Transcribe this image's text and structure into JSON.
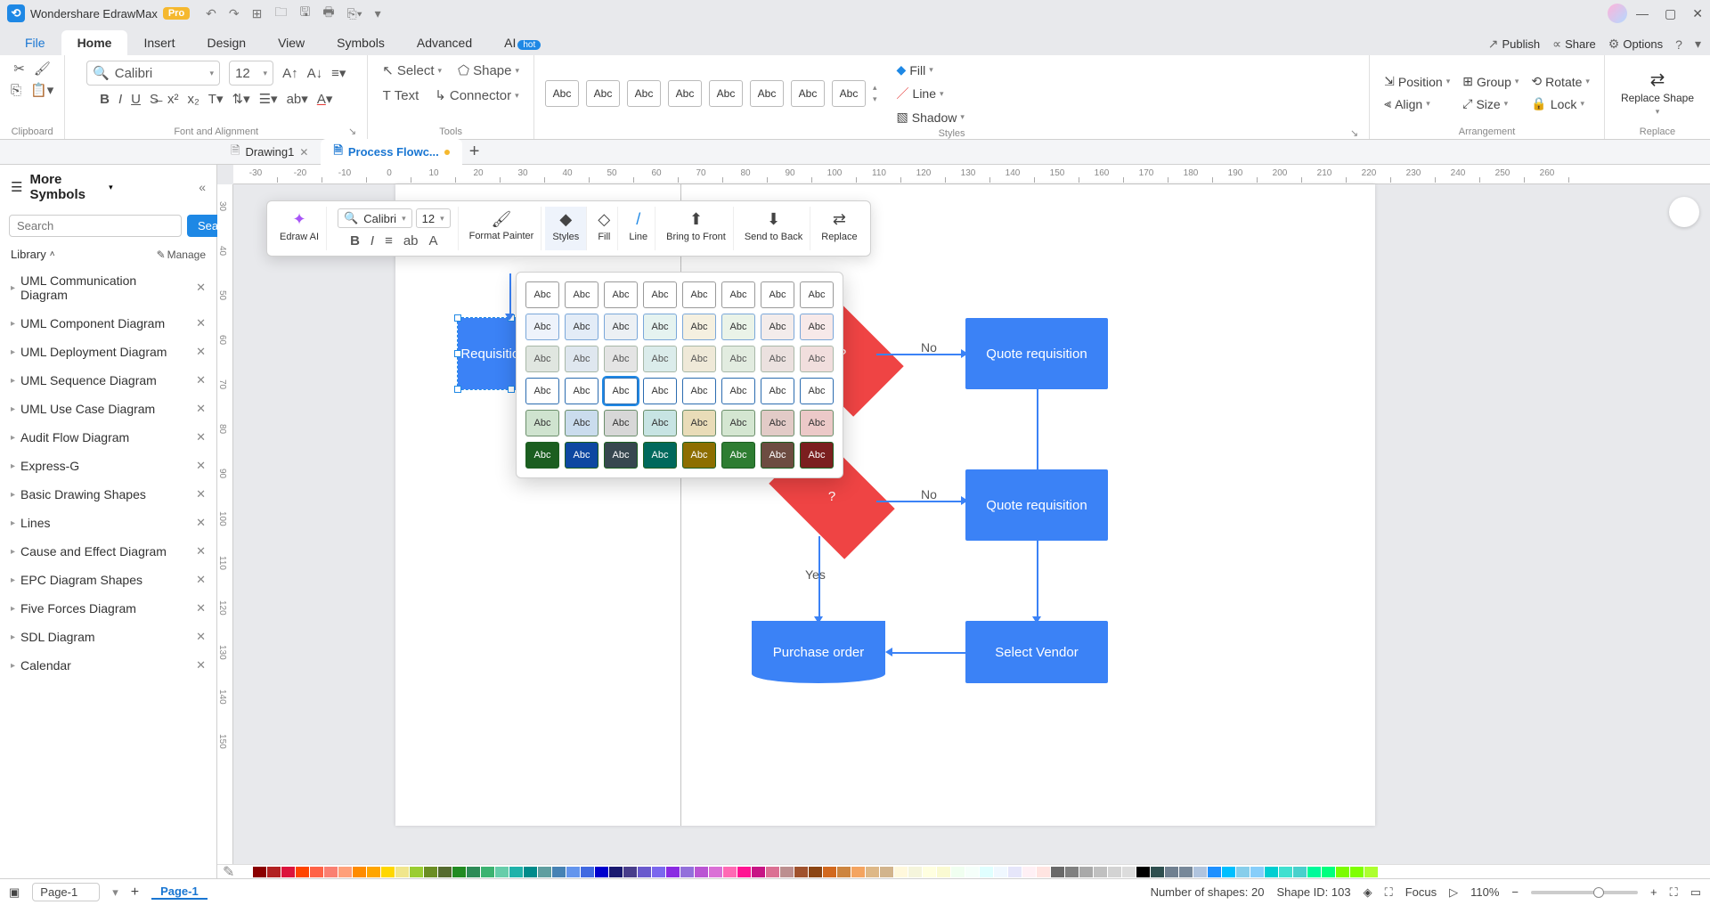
{
  "app": {
    "title": "Wondershare EdrawMax",
    "pro": "Pro"
  },
  "menu": {
    "file": "File",
    "home": "Home",
    "insert": "Insert",
    "design": "Design",
    "view": "View",
    "symbols": "Symbols",
    "advanced": "Advanced",
    "ai": "AI",
    "ai_badge": "hot"
  },
  "top_right": {
    "publish": "Publish",
    "share": "Share",
    "options": "Options"
  },
  "ribbon": {
    "clipboard": "Clipboard",
    "font_alignment": "Font and Alignment",
    "font_name": "Calibri",
    "font_size": "12",
    "tools": "Tools",
    "select": "Select",
    "text": "Text",
    "shape": "Shape",
    "connector": "Connector",
    "styles": "Styles",
    "style_swatch": "Abc",
    "fill": "Fill",
    "line": "Line",
    "shadow": "Shadow",
    "arrangement": "Arrangement",
    "position": "Position",
    "align": "Align",
    "group": "Group",
    "size": "Size",
    "rotate": "Rotate",
    "lock": "Lock",
    "replace": "Replace",
    "replace_shape": "Replace Shape"
  },
  "doc_tabs": {
    "drawing1": "Drawing1",
    "process": "Process Flowc..."
  },
  "sidebar": {
    "title": "More Symbols",
    "search_placeholder": "Search",
    "search_btn": "Search",
    "library": "Library",
    "manage": "Manage",
    "items": [
      "UML Communication Diagram",
      "UML Component Diagram",
      "UML Deployment Diagram",
      "UML Sequence Diagram",
      "UML Use Case Diagram",
      "Audit Flow Diagram",
      "Express-G",
      "Basic Drawing Shapes",
      "Lines",
      "Cause and Effect Diagram",
      "EPC Diagram Shapes",
      "Five Forces Diagram",
      "SDL Diagram",
      "Calendar"
    ]
  },
  "mini_toolbar": {
    "edraw_ai": "Edraw AI",
    "font_name": "Calibri",
    "font_size": "12",
    "format_painter": "Format Painter",
    "styles": "Styles",
    "fill": "Fill",
    "line": "Line",
    "bring_front": "Bring to Front",
    "send_back": "Send to Back",
    "replace": "Replace"
  },
  "style_swatch": "Abc",
  "canvas": {
    "requisition_form": "Requisition Form",
    "quote_req1": "Quote requisition",
    "quote_req2": "Quote requisition",
    "purchase_order": "Purchase order",
    "select_vendor": "Select Vendor",
    "decision_q": "t?",
    "decision2_q": "?",
    "no": "No",
    "yes": "Yes"
  },
  "ruler_h": [
    "-30",
    "-20",
    "-10",
    "0",
    "10",
    "20",
    "30",
    "40",
    "50",
    "60",
    "70",
    "80",
    "90",
    "100",
    "110",
    "120",
    "130",
    "140",
    "150",
    "160",
    "170",
    "180",
    "190",
    "200",
    "210",
    "220",
    "230",
    "240",
    "250",
    "260"
  ],
  "ruler_v": [
    "30",
    "40",
    "50",
    "60",
    "70",
    "80",
    "90",
    "100",
    "110",
    "120",
    "130",
    "140",
    "150"
  ],
  "status": {
    "page_sel": "Page-1",
    "page_tab": "Page-1",
    "shapes": "Number of shapes: 20",
    "shape_id": "Shape ID: 103",
    "focus": "Focus",
    "zoom": "110%"
  },
  "color_strip": [
    "#ffffff",
    "#8b0000",
    "#b22222",
    "#dc143c",
    "#ff4500",
    "#ff6347",
    "#fa8072",
    "#ffa07a",
    "#ff8c00",
    "#ffa500",
    "#ffd700",
    "#f0e68c",
    "#9acd32",
    "#6b8e23",
    "#556b2f",
    "#228b22",
    "#2e8b57",
    "#3cb371",
    "#66cdaa",
    "#20b2aa",
    "#008b8b",
    "#5f9ea0",
    "#4682b4",
    "#6495ed",
    "#4169e1",
    "#0000cd",
    "#191970",
    "#483d8b",
    "#6a5acd",
    "#7b68ee",
    "#8a2be2",
    "#9370db",
    "#ba55d3",
    "#da70d6",
    "#ff69b4",
    "#ff1493",
    "#c71585",
    "#db7093",
    "#bc8f8f",
    "#a0522d",
    "#8b4513",
    "#d2691e",
    "#cd853f",
    "#f4a460",
    "#deb887",
    "#d2b48c",
    "#fff8dc",
    "#f5f5dc",
    "#ffffe0",
    "#fafad2",
    "#f0fff0",
    "#f5fffa",
    "#e0ffff",
    "#f0f8ff",
    "#e6e6fa",
    "#fff0f5",
    "#ffe4e1",
    "#696969",
    "#808080",
    "#a9a9a9",
    "#c0c0c0",
    "#d3d3d3",
    "#dcdcdc",
    "#000000",
    "#2f4f4f",
    "#708090",
    "#778899",
    "#b0c4de",
    "#1e90ff",
    "#00bfff",
    "#87ceeb",
    "#87cefa",
    "#00ced1",
    "#40e0d0",
    "#48d1cc",
    "#00fa9a",
    "#00ff7f",
    "#7cfc00",
    "#7fff00",
    "#adff2f"
  ]
}
